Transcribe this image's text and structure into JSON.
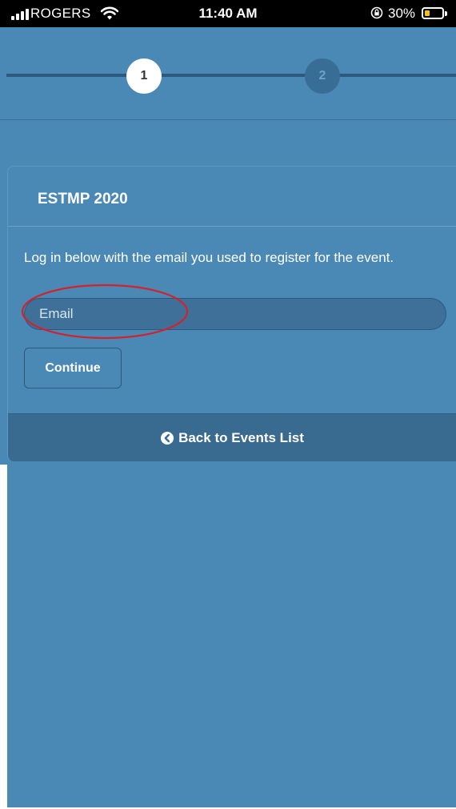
{
  "status_bar": {
    "carrier": "ROGERS",
    "time": "11:40 AM",
    "battery_percent": "30%",
    "battery_level": 0.3,
    "icons": [
      "signal-icon",
      "wifi-icon",
      "rotation-lock-icon",
      "battery-icon"
    ]
  },
  "stepper": {
    "steps": [
      {
        "label": "1",
        "active": true
      },
      {
        "label": "2",
        "active": false
      }
    ]
  },
  "card": {
    "title": "ESTMP 2020",
    "intro": "Log in below with the email you used to register for the event.",
    "email_placeholder": "Email",
    "email_value": "",
    "continue_label": "Continue",
    "back_label": "Back to Events List",
    "back_icon": "chevron-left-circle-icon"
  },
  "colors": {
    "background": "#4a88b5",
    "status_bar": "#000000",
    "back_bar": "#396a90",
    "annotation": "#d0242c"
  }
}
